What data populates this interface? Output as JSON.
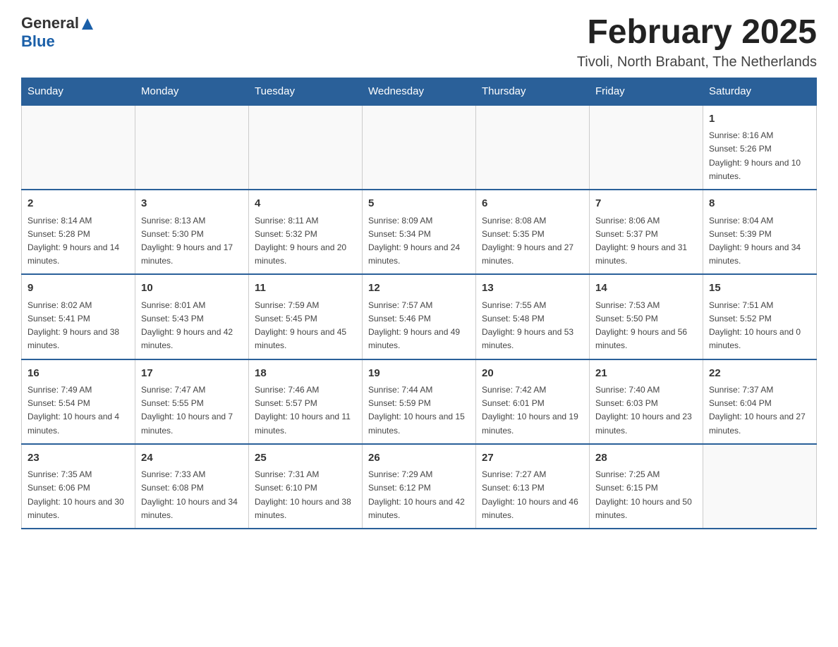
{
  "header": {
    "logo": {
      "text_general": "General",
      "text_blue": "Blue",
      "alt": "GeneralBlue logo"
    },
    "title": "February 2025",
    "subtitle": "Tivoli, North Brabant, The Netherlands"
  },
  "calendar": {
    "days_of_week": [
      "Sunday",
      "Monday",
      "Tuesday",
      "Wednesday",
      "Thursday",
      "Friday",
      "Saturday"
    ],
    "weeks": [
      [
        {
          "day": "",
          "info": ""
        },
        {
          "day": "",
          "info": ""
        },
        {
          "day": "",
          "info": ""
        },
        {
          "day": "",
          "info": ""
        },
        {
          "day": "",
          "info": ""
        },
        {
          "day": "",
          "info": ""
        },
        {
          "day": "1",
          "info": "Sunrise: 8:16 AM\nSunset: 5:26 PM\nDaylight: 9 hours and 10 minutes."
        }
      ],
      [
        {
          "day": "2",
          "info": "Sunrise: 8:14 AM\nSunset: 5:28 PM\nDaylight: 9 hours and 14 minutes."
        },
        {
          "day": "3",
          "info": "Sunrise: 8:13 AM\nSunset: 5:30 PM\nDaylight: 9 hours and 17 minutes."
        },
        {
          "day": "4",
          "info": "Sunrise: 8:11 AM\nSunset: 5:32 PM\nDaylight: 9 hours and 20 minutes."
        },
        {
          "day": "5",
          "info": "Sunrise: 8:09 AM\nSunset: 5:34 PM\nDaylight: 9 hours and 24 minutes."
        },
        {
          "day": "6",
          "info": "Sunrise: 8:08 AM\nSunset: 5:35 PM\nDaylight: 9 hours and 27 minutes."
        },
        {
          "day": "7",
          "info": "Sunrise: 8:06 AM\nSunset: 5:37 PM\nDaylight: 9 hours and 31 minutes."
        },
        {
          "day": "8",
          "info": "Sunrise: 8:04 AM\nSunset: 5:39 PM\nDaylight: 9 hours and 34 minutes."
        }
      ],
      [
        {
          "day": "9",
          "info": "Sunrise: 8:02 AM\nSunset: 5:41 PM\nDaylight: 9 hours and 38 minutes."
        },
        {
          "day": "10",
          "info": "Sunrise: 8:01 AM\nSunset: 5:43 PM\nDaylight: 9 hours and 42 minutes."
        },
        {
          "day": "11",
          "info": "Sunrise: 7:59 AM\nSunset: 5:45 PM\nDaylight: 9 hours and 45 minutes."
        },
        {
          "day": "12",
          "info": "Sunrise: 7:57 AM\nSunset: 5:46 PM\nDaylight: 9 hours and 49 minutes."
        },
        {
          "day": "13",
          "info": "Sunrise: 7:55 AM\nSunset: 5:48 PM\nDaylight: 9 hours and 53 minutes."
        },
        {
          "day": "14",
          "info": "Sunrise: 7:53 AM\nSunset: 5:50 PM\nDaylight: 9 hours and 56 minutes."
        },
        {
          "day": "15",
          "info": "Sunrise: 7:51 AM\nSunset: 5:52 PM\nDaylight: 10 hours and 0 minutes."
        }
      ],
      [
        {
          "day": "16",
          "info": "Sunrise: 7:49 AM\nSunset: 5:54 PM\nDaylight: 10 hours and 4 minutes."
        },
        {
          "day": "17",
          "info": "Sunrise: 7:47 AM\nSunset: 5:55 PM\nDaylight: 10 hours and 7 minutes."
        },
        {
          "day": "18",
          "info": "Sunrise: 7:46 AM\nSunset: 5:57 PM\nDaylight: 10 hours and 11 minutes."
        },
        {
          "day": "19",
          "info": "Sunrise: 7:44 AM\nSunset: 5:59 PM\nDaylight: 10 hours and 15 minutes."
        },
        {
          "day": "20",
          "info": "Sunrise: 7:42 AM\nSunset: 6:01 PM\nDaylight: 10 hours and 19 minutes."
        },
        {
          "day": "21",
          "info": "Sunrise: 7:40 AM\nSunset: 6:03 PM\nDaylight: 10 hours and 23 minutes."
        },
        {
          "day": "22",
          "info": "Sunrise: 7:37 AM\nSunset: 6:04 PM\nDaylight: 10 hours and 27 minutes."
        }
      ],
      [
        {
          "day": "23",
          "info": "Sunrise: 7:35 AM\nSunset: 6:06 PM\nDaylight: 10 hours and 30 minutes."
        },
        {
          "day": "24",
          "info": "Sunrise: 7:33 AM\nSunset: 6:08 PM\nDaylight: 10 hours and 34 minutes."
        },
        {
          "day": "25",
          "info": "Sunrise: 7:31 AM\nSunset: 6:10 PM\nDaylight: 10 hours and 38 minutes."
        },
        {
          "day": "26",
          "info": "Sunrise: 7:29 AM\nSunset: 6:12 PM\nDaylight: 10 hours and 42 minutes."
        },
        {
          "day": "27",
          "info": "Sunrise: 7:27 AM\nSunset: 6:13 PM\nDaylight: 10 hours and 46 minutes."
        },
        {
          "day": "28",
          "info": "Sunrise: 7:25 AM\nSunset: 6:15 PM\nDaylight: 10 hours and 50 minutes."
        },
        {
          "day": "",
          "info": ""
        }
      ]
    ]
  }
}
